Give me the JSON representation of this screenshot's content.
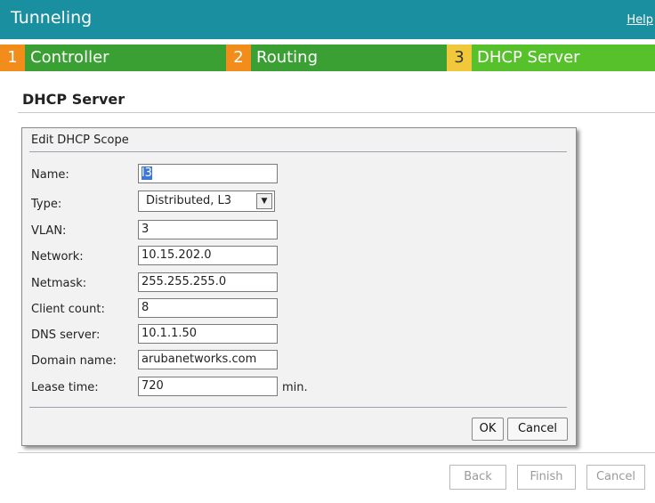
{
  "header": {
    "title": "Tunneling",
    "help": "Help"
  },
  "steps": [
    {
      "num": "1",
      "label": "Controller"
    },
    {
      "num": "2",
      "label": "Routing"
    },
    {
      "num": "3",
      "label": "DHCP Server"
    }
  ],
  "section": {
    "title": "DHCP Server"
  },
  "dialog": {
    "title": "Edit DHCP Scope",
    "fields": {
      "name": {
        "label": "Name:",
        "value": "l3"
      },
      "type": {
        "label": "Type:",
        "value": "Distributed, L3"
      },
      "vlan": {
        "label": "VLAN:",
        "value": "3"
      },
      "network": {
        "label": "Network:",
        "value": "10.15.202.0"
      },
      "netmask": {
        "label": "Netmask:",
        "value": "255.255.255.0"
      },
      "client_count": {
        "label": "Client count:",
        "value": "8"
      },
      "dns_server": {
        "label": "DNS server:",
        "value": "10.1.1.50"
      },
      "domain_name": {
        "label": "Domain name:",
        "value": "arubanetworks.com"
      },
      "lease_time": {
        "label": "Lease time:",
        "value": "720",
        "unit": "min."
      }
    },
    "ok_label": "OK",
    "cancel_label": "Cancel"
  },
  "footer": {
    "back_label": "Back",
    "finish_label": "Finish",
    "cancel_label": "Cancel"
  }
}
